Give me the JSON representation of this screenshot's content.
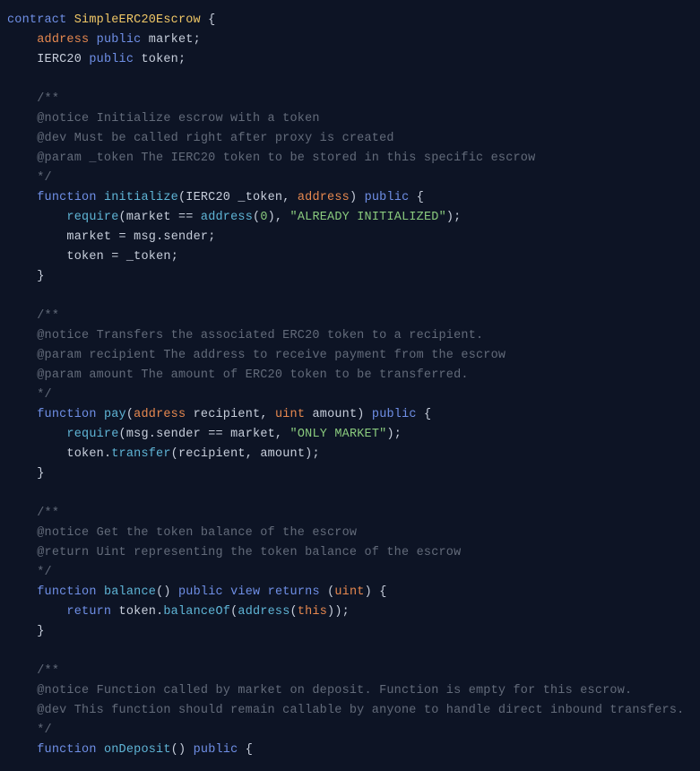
{
  "code": {
    "contract_kw": "contract",
    "contract_name": "SimpleERC20Escrow",
    "decl_address": "address",
    "decl_public": "public",
    "decl_market": "market",
    "decl_ierc20": "IERC20",
    "decl_token": "token",
    "c1_open": "/**",
    "c1_l1": "@notice Initialize escrow with a token",
    "c1_l2": "@dev Must be called right after proxy is created",
    "c1_l3": "@param _token The IERC20 token to be stored in this specific escrow",
    "c1_close": "*/",
    "fn_kw": "function",
    "fn_initialize": "initialize",
    "init_p1_type": "IERC20",
    "init_p1_name": "_token",
    "init_p2_type": "address",
    "public_kw": "public",
    "require_fn": "require",
    "init_req_lhs": "market",
    "init_req_op": "==",
    "init_req_addr": "address",
    "init_req_zero": "0",
    "init_req_str": "\"ALREADY INITIALIZED\"",
    "init_a1_l": "market",
    "init_a1_msg": "msg",
    "init_a1_sender": "sender",
    "init_a2_l": "token",
    "init_a2_r": "_token",
    "c2_open": "/**",
    "c2_l1": "@notice Transfers the associated ERC20 token to a recipient.",
    "c2_l2": "@param recipient The address to receive payment from the escrow",
    "c2_l3": "@param amount The amount of ERC20 token to be transferred.",
    "c2_close": "*/",
    "fn_pay": "pay",
    "pay_p1_type": "address",
    "pay_p1_name": "recipient",
    "pay_p2_type": "uint",
    "pay_p2_name": "amount",
    "pay_req_msg": "msg",
    "pay_req_sender": "sender",
    "pay_req_market": "market",
    "pay_req_str": "\"ONLY MARKET\"",
    "pay_token": "token",
    "pay_transfer": "transfer",
    "pay_arg1": "recipient",
    "pay_arg2": "amount",
    "c3_open": "/**",
    "c3_l1": "@notice Get the token balance of the escrow",
    "c3_l2": "@return Uint representing the token balance of the escrow",
    "c3_close": "*/",
    "fn_balance": "balance",
    "view_kw": "view",
    "returns_kw": "returns",
    "uint_kw": "uint",
    "return_kw": "return",
    "bal_token": "token",
    "bal_balanceOf": "balanceOf",
    "bal_address": "address",
    "bal_this": "this",
    "c4_open": "/**",
    "c4_l1": "@notice Function called by market on deposit. Function is empty for this escrow.",
    "c4_l2": "@dev This function should remain callable by anyone to handle direct inbound transfers.",
    "c4_close": "*/",
    "fn_onDeposit": "onDeposit"
  }
}
